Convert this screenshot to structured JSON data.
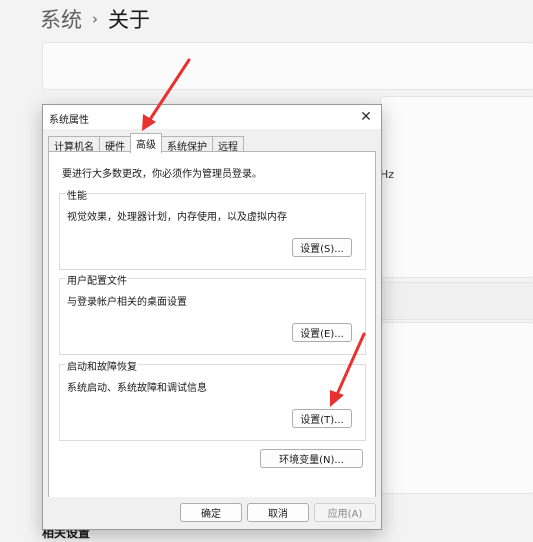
{
  "background": {
    "breadcrumb": {
      "parent": "系统",
      "current": "关于"
    },
    "hz_fragment": "Hz",
    "related_heading": "相关设置"
  },
  "dialog": {
    "title": "系统属性",
    "close_glyph": "✕",
    "tabs": [
      {
        "label": "计算机名",
        "active": false
      },
      {
        "label": "硬件",
        "active": false
      },
      {
        "label": "高级",
        "active": true
      },
      {
        "label": "系统保护",
        "active": false
      },
      {
        "label": "远程",
        "active": false
      }
    ],
    "admin_note": "要进行大多数更改，你必须作为管理员登录。",
    "groups": {
      "performance": {
        "label": "性能",
        "desc": "视觉效果，处理器计划，内存使用，以及虚拟内存",
        "button": "设置(S)..."
      },
      "user_profiles": {
        "label": "用户配置文件",
        "desc": "与登录帐户相关的桌面设置",
        "button": "设置(E)..."
      },
      "startup_recovery": {
        "label": "启动和故障恢复",
        "desc": "系统启动、系统故障和调试信息",
        "button": "设置(T)..."
      }
    },
    "env_button": "环境变量(N)...",
    "footer": {
      "ok": "确定",
      "cancel": "取消",
      "apply": "应用(A)"
    }
  },
  "annotation": {
    "arrow_color": "#e8322f"
  }
}
